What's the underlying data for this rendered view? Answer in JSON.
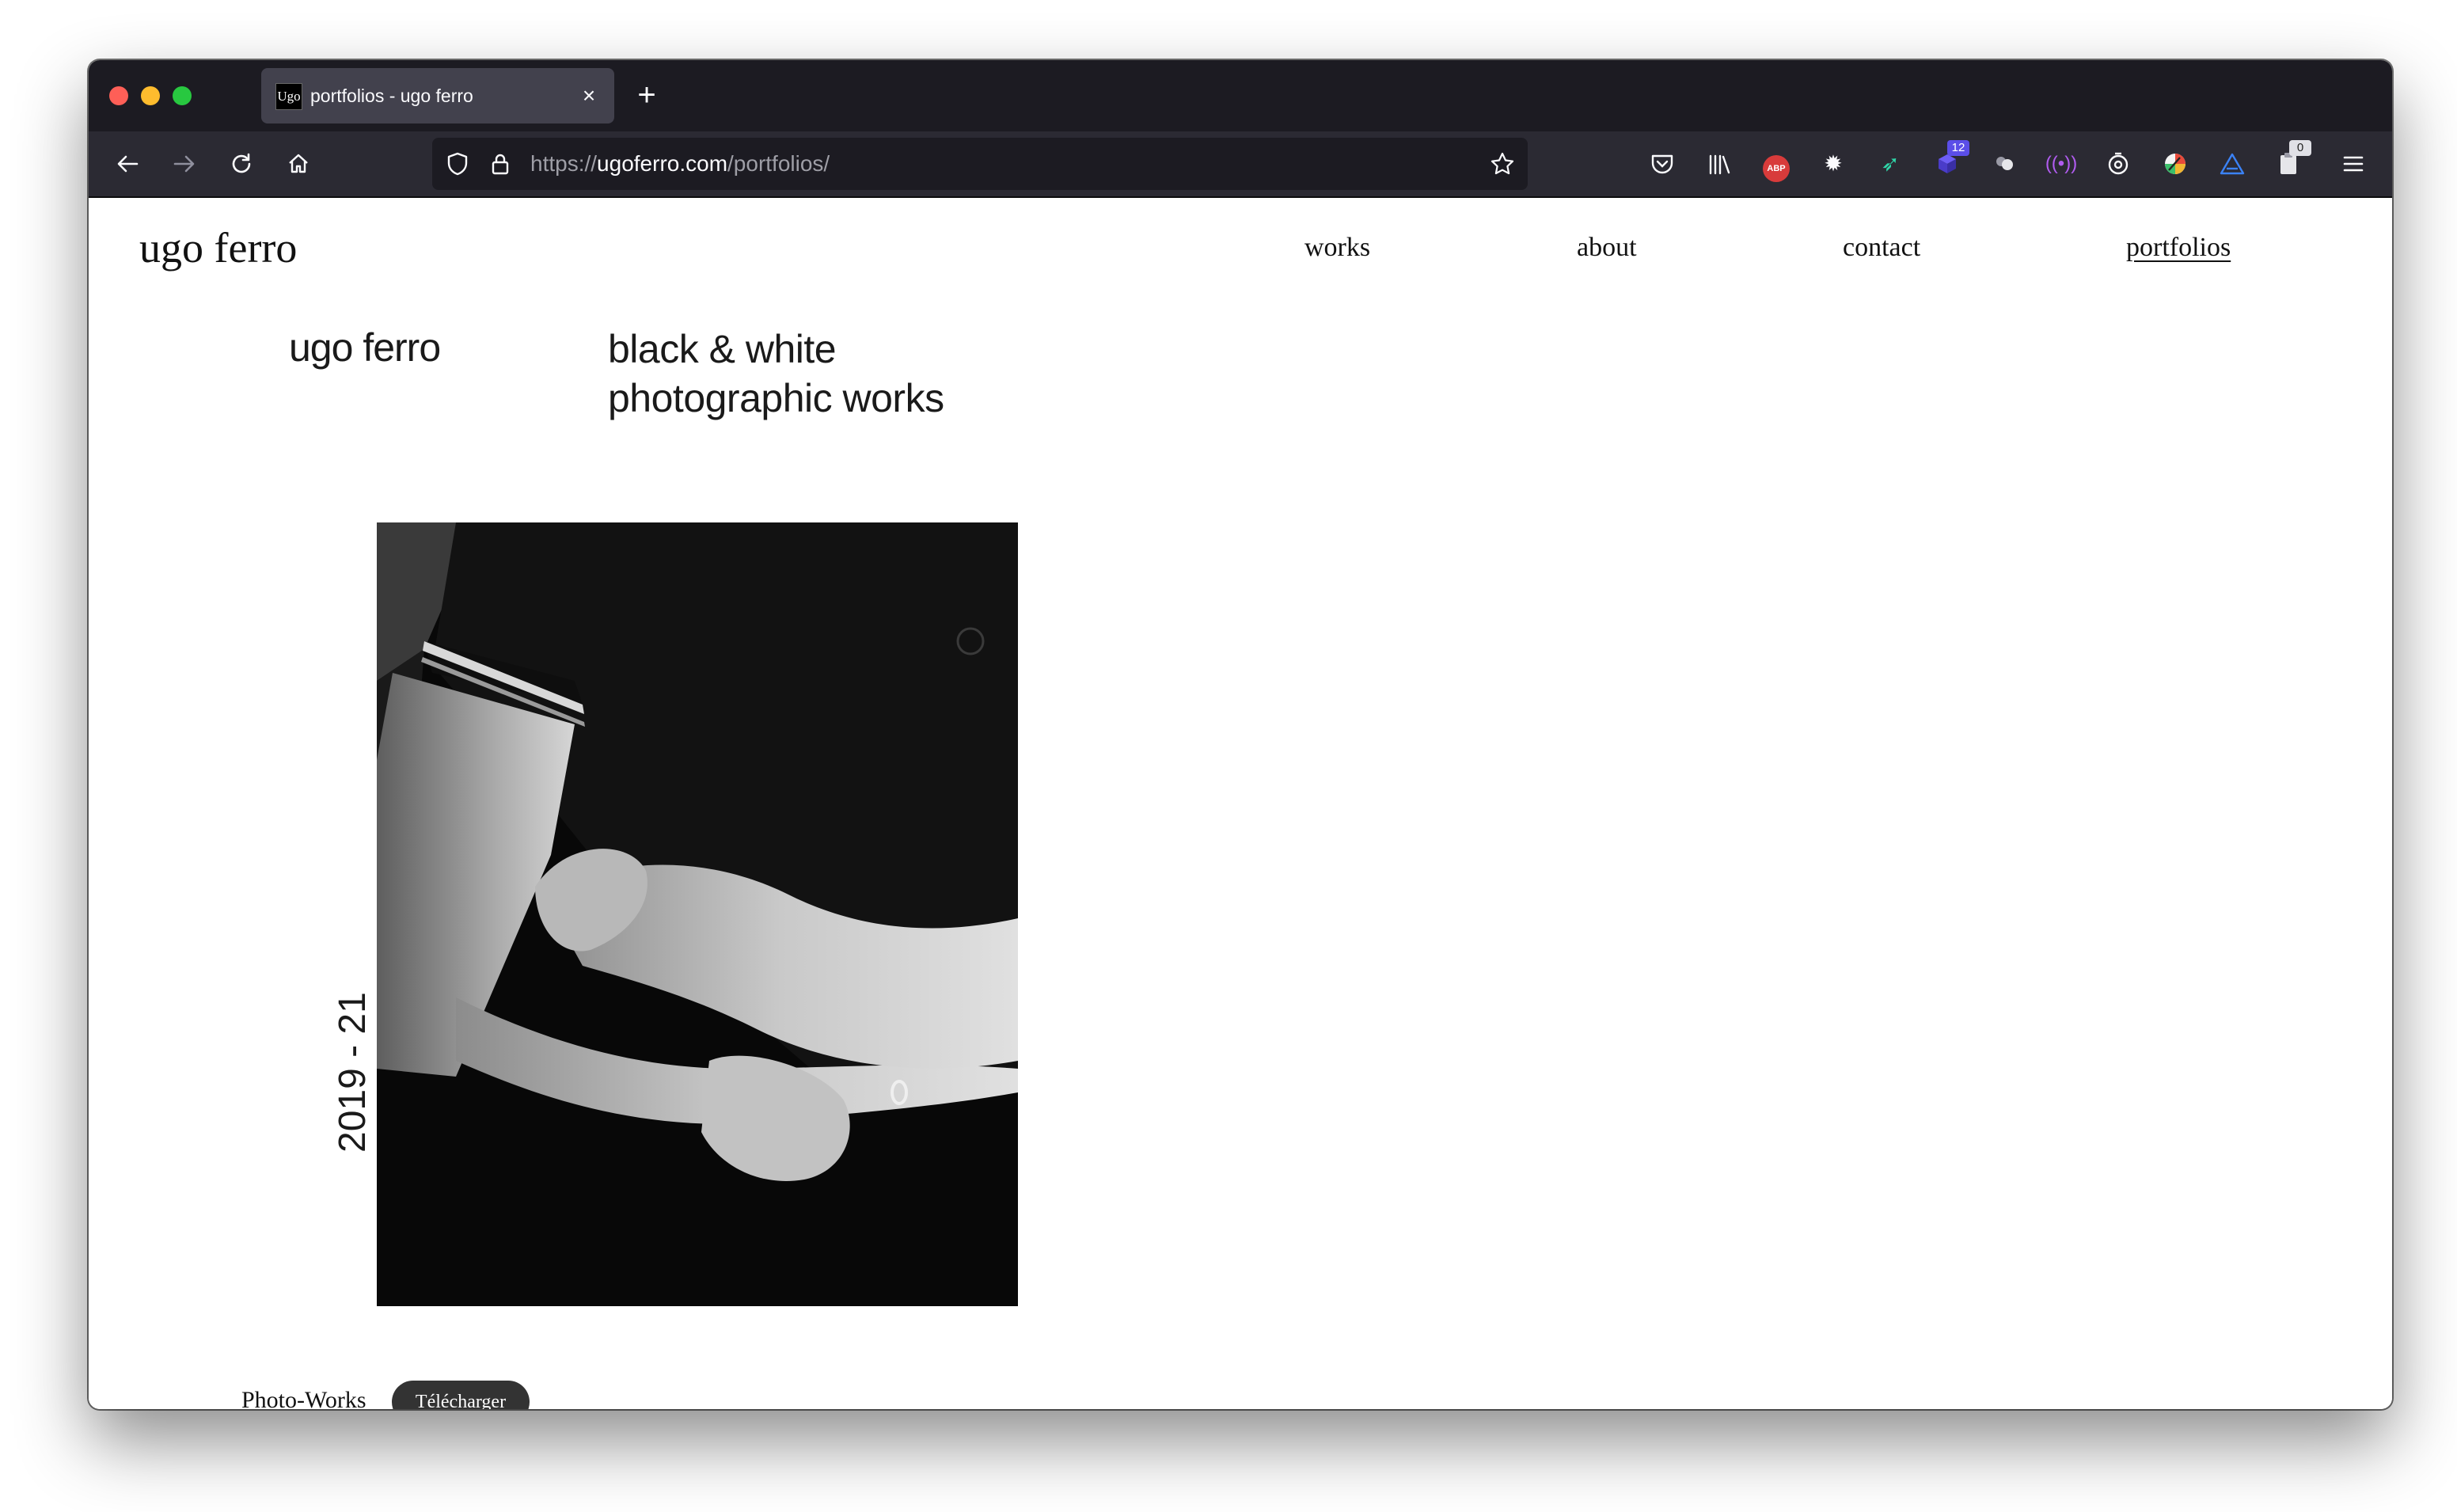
{
  "browser": {
    "tab": {
      "favicon_text": "Ugo",
      "title": "portfolios - ugo ferro"
    },
    "url": {
      "scheme": "https://",
      "host": "ugoferro.com",
      "path": "/portfolios/"
    },
    "extensions": [
      {
        "icon": "pocket-icon"
      },
      {
        "icon": "library-icon"
      },
      {
        "icon": "adblock-plus-icon",
        "label": "ABP"
      },
      {
        "icon": "gear-extension-icon"
      },
      {
        "icon": "bird-extension-icon"
      },
      {
        "icon": "cube-extension-icon",
        "badge": "12"
      },
      {
        "icon": "people-extension-icon"
      },
      {
        "icon": "broadcast-extension-icon"
      },
      {
        "icon": "timer-extension-icon"
      },
      {
        "icon": "color-wheel-extension-icon"
      },
      {
        "icon": "triangle-extension-icon"
      },
      {
        "icon": "clipboard-extension-icon",
        "badge": "0"
      }
    ]
  },
  "site": {
    "brand": "ugo ferro",
    "nav": [
      {
        "label": "works"
      },
      {
        "label": "about"
      },
      {
        "label": "contact"
      },
      {
        "label": "portfolios",
        "active": true
      }
    ]
  },
  "portfolio": {
    "artist": "ugo ferro",
    "title_line1": "black & white",
    "title_line2": "photographic works",
    "years": "2019 - 21",
    "caption": "Photo-Works",
    "download_label": "Télécharger"
  },
  "colors": {
    "tabstrip_bg": "#1c1b22",
    "toolbar_bg": "#2b2a33",
    "download_button_bg": "#333333"
  }
}
